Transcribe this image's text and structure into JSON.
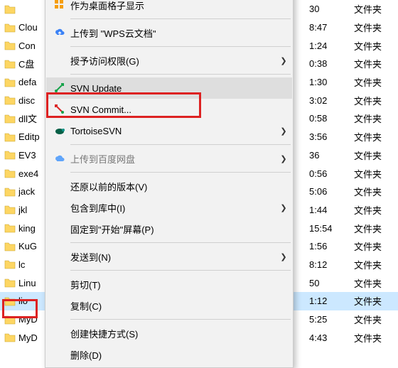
{
  "files": [
    {
      "name": "",
      "time": "30",
      "type": "文件夹",
      "sel": false
    },
    {
      "name": "Clou",
      "time": "8:47",
      "type": "文件夹",
      "sel": false
    },
    {
      "name": "Con",
      "time": "1:24",
      "type": "文件夹",
      "sel": false
    },
    {
      "name": "C盘",
      "time": "0:38",
      "type": "文件夹",
      "sel": false
    },
    {
      "name": "defa",
      "time": "1:30",
      "type": "文件夹",
      "sel": false
    },
    {
      "name": "disc",
      "time": "3:02",
      "type": "文件夹",
      "sel": false
    },
    {
      "name": "dll文",
      "time": "0:58",
      "type": "文件夹",
      "sel": false
    },
    {
      "name": "Editp",
      "time": "3:56",
      "type": "文件夹",
      "sel": false
    },
    {
      "name": "EV3",
      "time": "36",
      "type": "文件夹",
      "sel": false
    },
    {
      "name": "exe4",
      "time": "0:56",
      "type": "文件夹",
      "sel": false
    },
    {
      "name": "jack",
      "time": "5:06",
      "type": "文件夹",
      "sel": false
    },
    {
      "name": "jkl",
      "time": "1:44",
      "type": "文件夹",
      "sel": false
    },
    {
      "name": "king",
      "time": "15:54",
      "type": "文件夹",
      "sel": false
    },
    {
      "name": "KuG",
      "time": "1:56",
      "type": "文件夹",
      "sel": false
    },
    {
      "name": "lc",
      "time": "8:12",
      "type": "文件夹",
      "sel": false
    },
    {
      "name": "Linu",
      "time": "50",
      "type": "文件夹",
      "sel": false
    },
    {
      "name": "lio",
      "time": "1:12",
      "type": "文件夹",
      "sel": true
    },
    {
      "name": "MyD",
      "time": "5:25",
      "type": "文件夹",
      "sel": false
    },
    {
      "name": "MyD",
      "time": "4:43",
      "type": "文件夹",
      "sel": false
    }
  ],
  "menu": {
    "desktop_grid": "作为桌面格子显示",
    "upload_wps": "上传到 \"WPS云文档\"",
    "grant_access": "授予访问权限(G)",
    "svn_update": "SVN Update",
    "svn_commit": "SVN Commit...",
    "tortoise_svn": "TortoiseSVN",
    "upload_baidu": "上传到百度网盘",
    "restore_prev": "还原以前的版本(V)",
    "include_lib": "包含到库中(I)",
    "pin_start": "固定到\"开始\"屏幕(P)",
    "send_to": "发送到(N)",
    "cut": "剪切(T)",
    "copy": "复制(C)",
    "create_shortcut": "创建快捷方式(S)",
    "delete": "删除(D)"
  }
}
